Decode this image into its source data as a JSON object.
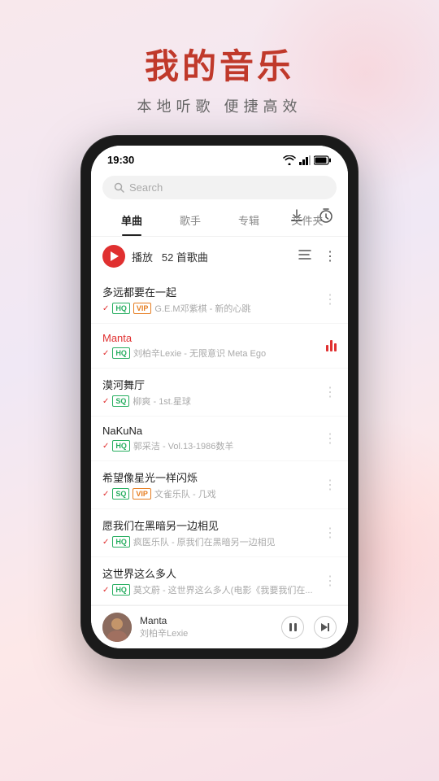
{
  "app": {
    "title": "我的音乐",
    "subtitle": "本地听歌 便捷高效"
  },
  "status_bar": {
    "time": "19:30"
  },
  "search": {
    "placeholder": "Search"
  },
  "tabs": [
    {
      "label": "单曲",
      "active": true
    },
    {
      "label": "歌手",
      "active": false
    },
    {
      "label": "专辑",
      "active": false
    },
    {
      "label": "文件夹",
      "active": false
    }
  ],
  "play_bar": {
    "label": "播放",
    "count": "52 首歌曲"
  },
  "songs": [
    {
      "title": "多远都要在一起",
      "title_color": "normal",
      "badges": [
        "HQ",
        "VIP"
      ],
      "artist": "G.E.M邓紫棋",
      "album": "新的心跳",
      "playing": false
    },
    {
      "title": "Manta",
      "title_color": "red",
      "badges": [
        "HQ"
      ],
      "artist": "刘柏辛Lexie",
      "album": "无限意识 Meta Ego",
      "playing": true
    },
    {
      "title": "漠河舞厅",
      "title_color": "normal",
      "badges": [
        "SQ"
      ],
      "artist": "柳爽",
      "album": "1st.星球",
      "playing": false
    },
    {
      "title": "NaKuNa",
      "title_color": "normal",
      "badges": [
        "HQ"
      ],
      "artist": "郭采洁",
      "album": "Vol.13-1986数羊",
      "playing": false
    },
    {
      "title": "希望像星光一样闪烁",
      "title_color": "normal",
      "badges": [
        "SQ",
        "VIP"
      ],
      "artist": "文雀乐队",
      "album": "几戏",
      "playing": false
    },
    {
      "title": "愿我们在黑暗另一边相见",
      "title_color": "normal",
      "badges": [
        "HQ"
      ],
      "artist": "疯医乐队",
      "album": "原我们在黑暗另一边相见",
      "playing": false
    },
    {
      "title": "这世界这么多人",
      "title_color": "normal",
      "badges": [
        "HQ"
      ],
      "artist": "莫文蔚",
      "album": "这世界这么多人(电影《我要我们在...",
      "playing": false
    }
  ],
  "now_playing": {
    "title": "Manta",
    "artist": "刘柏辛Lexie"
  }
}
